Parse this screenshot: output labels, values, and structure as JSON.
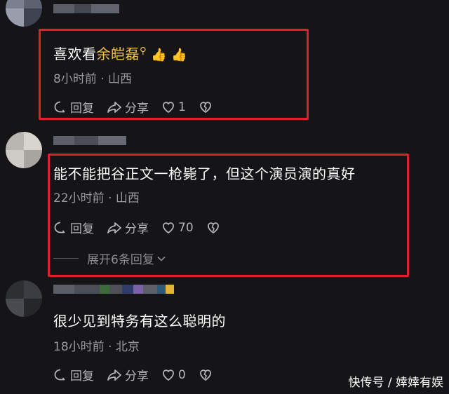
{
  "comments": [
    {
      "text_prefix": "喜欢看",
      "mention": "余皑磊",
      "search_glyph": "⚲",
      "thumbs": [
        "👍",
        "👍"
      ],
      "time": "8小时前",
      "location": "山西",
      "reply_label": "回复",
      "share_label": "分享",
      "like_count": "1"
    },
    {
      "text": "能不能把谷正文一枪毙了，但这个演员演的真好",
      "time": "22小时前",
      "location": "山西",
      "reply_label": "回复",
      "share_label": "分享",
      "like_count": "70",
      "replies_label": "展开6条回复"
    },
    {
      "text": "很少见到特务有这么聪明的",
      "time": "18小时前",
      "location": "北京",
      "reply_label": "回复",
      "share_label": "分享",
      "like_count": "0"
    }
  ],
  "meta_separator": "·",
  "watermark": "快传号 / 婞婞有娱",
  "colors": {
    "background": "#151518",
    "highlight_box": "#e0202a",
    "mention": "#f3c04a",
    "meta": "#9a9aa0"
  },
  "icons": [
    "reply-icon",
    "share-icon",
    "heart-icon",
    "broken-heart-icon",
    "search-icon",
    "thumbs-up-icon",
    "chevron-down-icon"
  ]
}
